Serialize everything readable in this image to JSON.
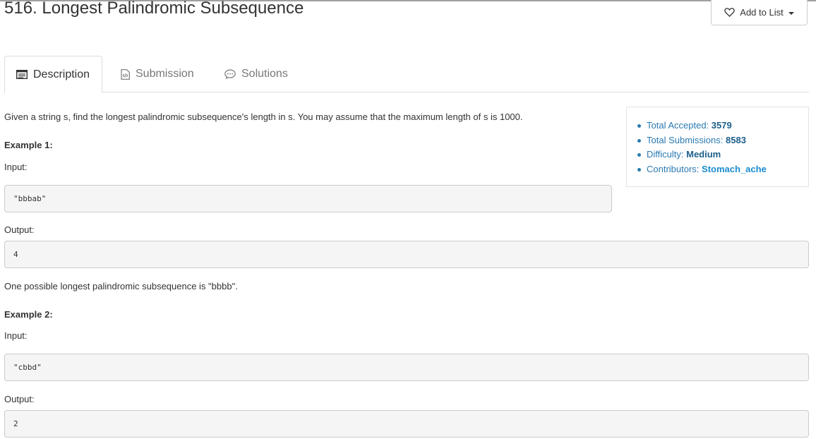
{
  "problem": {
    "title": "516. Longest Palindromic Subsequence",
    "add_to_list_label": "Add to List"
  },
  "tabs": [
    {
      "label": "Description",
      "icon": "list-icon",
      "active": true
    },
    {
      "label": "Submission",
      "icon": "code-file-icon",
      "active": false
    },
    {
      "label": "Solutions",
      "icon": "comment-icon",
      "active": false
    }
  ],
  "description": {
    "intro": "Given a string s, find the longest palindromic subsequence's length in s. You may assume that the maximum length of s is 1000.",
    "examples": [
      {
        "heading": "Example 1:",
        "input_label": "Input:",
        "input": "\"bbbab\"",
        "output_label": "Output:",
        "output": "4",
        "note": "One possible longest palindromic subsequence is \"bbbb\"."
      },
      {
        "heading": "Example 2:",
        "input_label": "Input:",
        "input": "\"cbbd\"",
        "output_label": "Output:",
        "output": "2"
      }
    ]
  },
  "stats": {
    "accepted_label": "Total Accepted:",
    "accepted": "3579",
    "submissions_label": "Total Submissions:",
    "submissions": "8583",
    "difficulty_label": "Difficulty:",
    "difficulty": "Medium",
    "contributors_label": "Contributors:",
    "contributors": "Stomach_ache"
  },
  "colors": {
    "link": "#1a8cd0",
    "stats_text": "#2a7ab0",
    "code_bg": "#f5f5f5"
  }
}
